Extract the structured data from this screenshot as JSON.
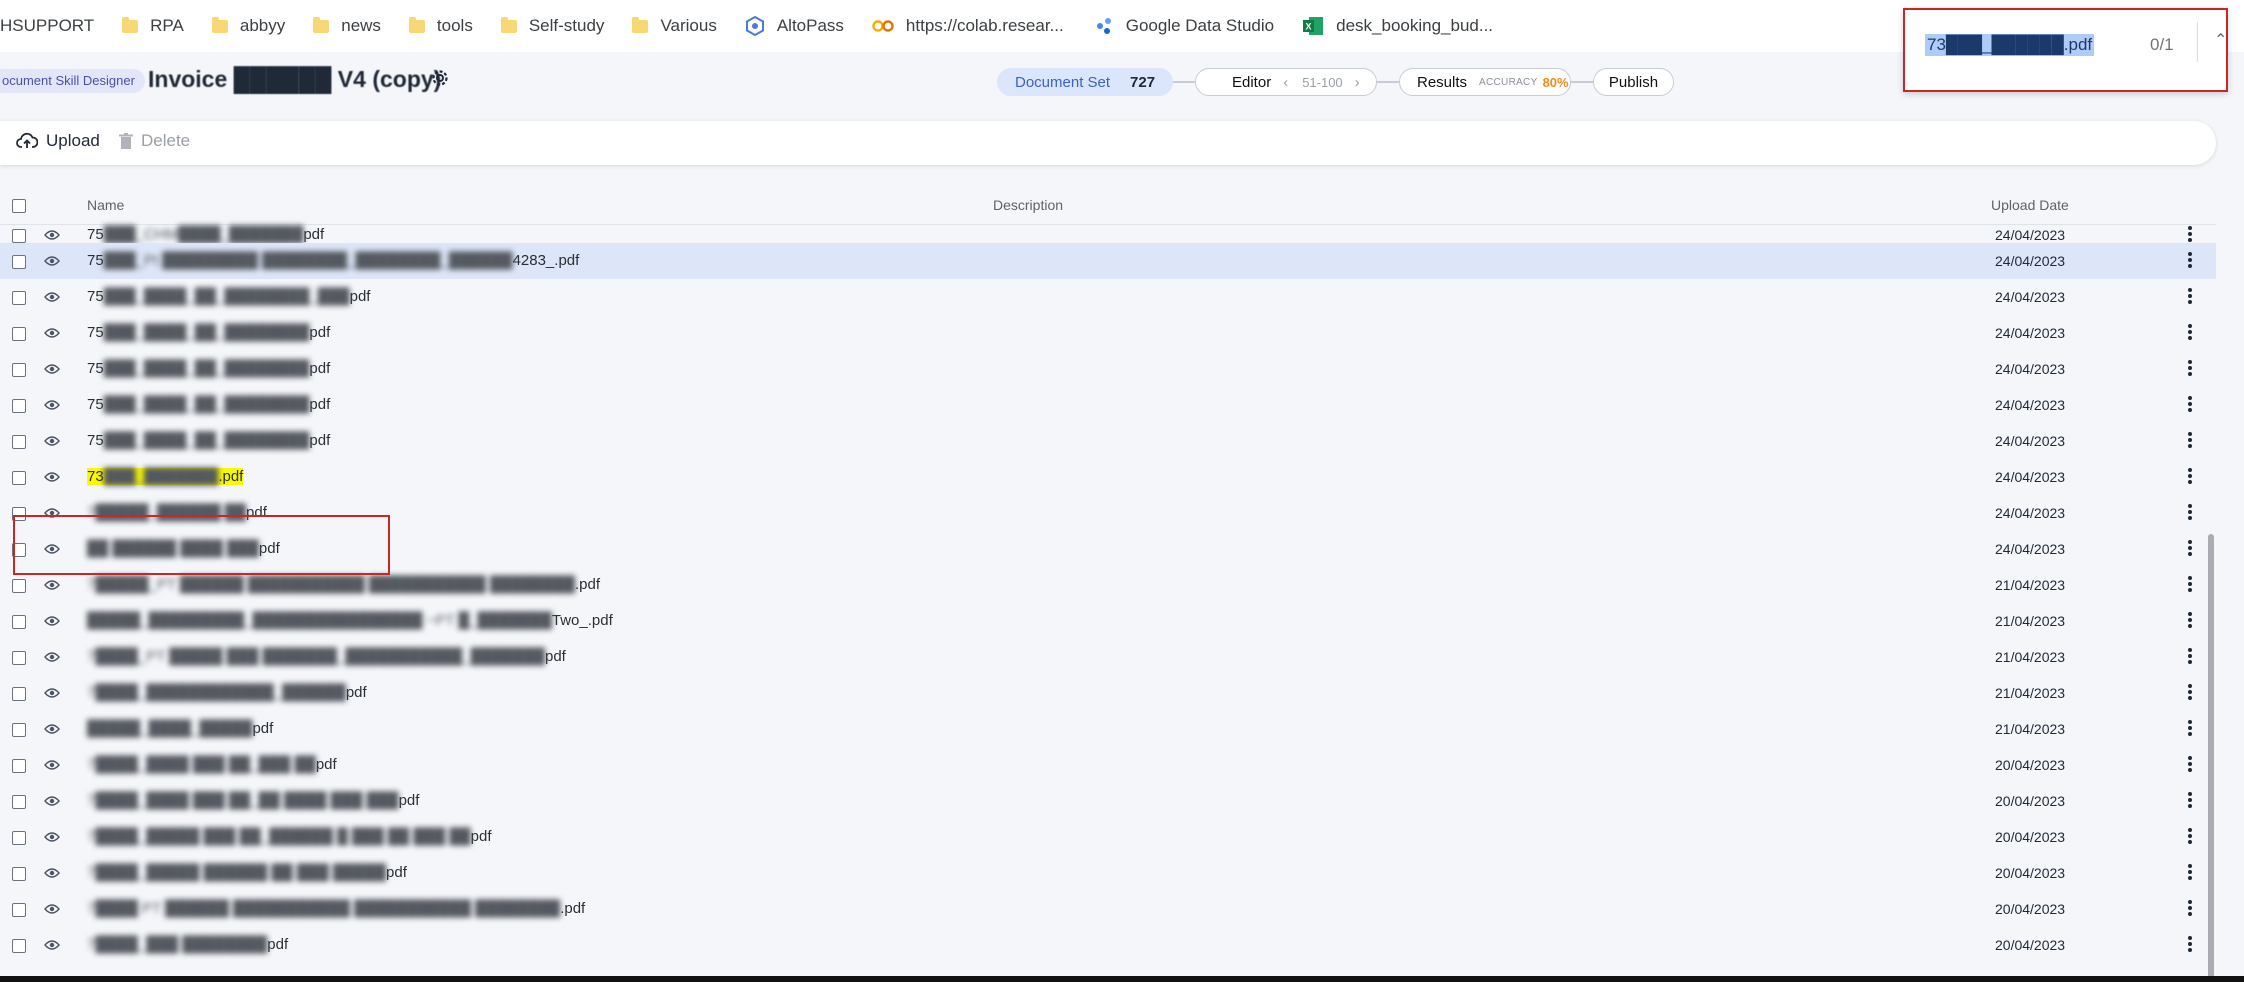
{
  "bookmarks": [
    {
      "label": "HSUPPORT",
      "icon": "none"
    },
    {
      "label": "RPA",
      "icon": "folder-icon"
    },
    {
      "label": "abbyy",
      "icon": "folder-icon"
    },
    {
      "label": "news",
      "icon": "folder-icon"
    },
    {
      "label": "tools",
      "icon": "folder-icon"
    },
    {
      "label": "Self-study",
      "icon": "folder-icon"
    },
    {
      "label": "Various",
      "icon": "folder-icon"
    },
    {
      "label": "AltoPass",
      "icon": "altopass-icon"
    },
    {
      "label": "https://colab.resear...",
      "icon": "colab-icon"
    },
    {
      "label": "Google Data Studio",
      "icon": "data-studio-icon"
    },
    {
      "label": "desk_booking_bud...",
      "icon": "excel-icon"
    }
  ],
  "find_bar": {
    "query": "73███_██████.pdf",
    "count": "0/1"
  },
  "header": {
    "breadcrumb": "ocument Skill Designer",
    "title": "Invoice ██████ V4 (copy)",
    "stages": {
      "document_set_label": "Document Set",
      "document_set_count": "727",
      "editor_label": "Editor",
      "editor_range": "51-100",
      "results_label": "Results",
      "accuracy_label": "ACCURACY",
      "accuracy_value": "80%",
      "publish_label": "Publish"
    }
  },
  "toolbar": {
    "upload_label": "Upload",
    "delete_label": "Delete"
  },
  "table": {
    "columns": {
      "name": "Name",
      "description": "Description",
      "upload_date": "Upload Date"
    },
    "rows": [
      {
        "prefix": "75",
        "blur": "███_CHM████_███████",
        "suffix": "pdf",
        "date": "24/04/2023"
      },
      {
        "prefix": "75",
        "blur": "███_Pt █████████ ████████_████████_██████",
        "suffix": "4283_.pdf",
        "date": "24/04/2023",
        "selected": true
      },
      {
        "prefix": "75",
        "blur": "███_████_██_████████_███",
        "suffix": "pdf",
        "date": "24/04/2023"
      },
      {
        "prefix": "75",
        "blur": "███_████_██_████████",
        "suffix": "pdf",
        "date": "24/04/2023"
      },
      {
        "prefix": "75",
        "blur": "███_████_██_████████",
        "suffix": "pdf",
        "date": "24/04/2023"
      },
      {
        "prefix": "75",
        "blur": "███_████_██_████████",
        "suffix": "pdf",
        "date": "24/04/2023"
      },
      {
        "prefix": "75",
        "blur": "███_████_██_████████",
        "suffix": "pdf",
        "date": "24/04/2023"
      },
      {
        "prefix": "73",
        "blur": "███_███████",
        "suffix": ".pdf",
        "date": "24/04/2023",
        "highlight": true
      },
      {
        "prefix": "",
        "blur": "7█████_██████ ██",
        "suffix": "pdf",
        "date": "24/04/2023"
      },
      {
        "prefix": "",
        "blur": "██ ██████ ████ ███",
        "suffix": "pdf",
        "date": "24/04/2023"
      },
      {
        "prefix": "",
        "blur": "7█████_PT ██████ ███████████ ███████████ ████████",
        "suffix": ".pdf",
        "date": "21/04/2023"
      },
      {
        "prefix": "",
        "blur": "█████_█████████_████████████████ ~PT █_███████",
        "suffix": "Two_.pdf",
        "date": "21/04/2023"
      },
      {
        "prefix": "",
        "blur": "7████_PT █████ ███ ███████_███████████_███████",
        "suffix": "pdf",
        "date": "21/04/2023"
      },
      {
        "prefix": "",
        "blur": "7████_████████████_██████",
        "suffix": "pdf",
        "date": "21/04/2023"
      },
      {
        "prefix": "",
        "blur": "█████_████_█████",
        "suffix": "pdf",
        "date": "21/04/2023"
      },
      {
        "prefix": "",
        "blur": "7████_████ ███ ██_███ ██",
        "suffix": "pdf",
        "date": "20/04/2023"
      },
      {
        "prefix": "",
        "blur": "7████_████ ███ ██_██ ████ ███ ███",
        "suffix": "pdf",
        "date": "20/04/2023"
      },
      {
        "prefix": "",
        "blur": "7████_█████ ███ ██_██████ █ ███ ██ ███ ██",
        "suffix": "pdf",
        "date": "20/04/2023"
      },
      {
        "prefix": "",
        "blur": "7████_█████ ██████ ██ ███ █████",
        "suffix": "pdf",
        "date": "20/04/2023"
      },
      {
        "prefix": "",
        "blur": "7████ PT ██████ ███████████ ███████████ ████████",
        "suffix": ".pdf",
        "date": "20/04/2023"
      },
      {
        "prefix": "",
        "blur": "7████_███ ████████",
        "suffix": "pdf",
        "date": "20/04/2023"
      }
    ]
  },
  "colors": {
    "accent": "#3a62c7",
    "accuracy": "#f08c1a",
    "annotation_box": "#c62828",
    "find_highlight": "#f8f900",
    "selected_row": "#dde6f8"
  }
}
